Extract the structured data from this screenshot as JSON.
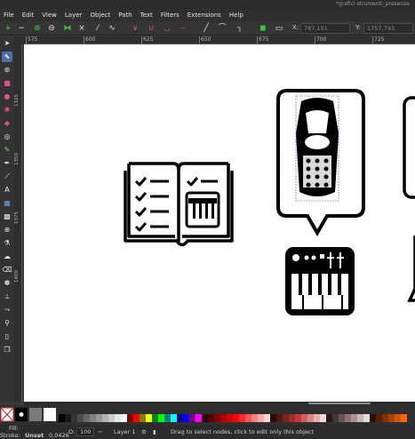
{
  "window": {
    "document_title": "*grafici strumenti_presenze"
  },
  "menubar": {
    "items": [
      "File",
      "Edit",
      "View",
      "Layer",
      "Object",
      "Path",
      "Text",
      "Filters",
      "Extensions",
      "Help"
    ]
  },
  "controls": {
    "x_label": "X:",
    "x_value": "787,151",
    "y_label": "Y:",
    "y_value": "1757,793"
  },
  "ruler": {
    "top_labels": [
      "575",
      "600",
      "625",
      "650",
      "675",
      "700",
      "725"
    ],
    "left_labels": [
      "1325",
      "1350",
      "1375",
      "1400"
    ]
  },
  "statusbar": {
    "fill_label": "Fill:",
    "stroke_label": "Stroke:",
    "stroke_value": "Unset",
    "stroke_width": "0,0426",
    "opacity_label": "O:",
    "opacity_value": "100",
    "layer_name": "Layer 1",
    "message": "Drag to select nodes, click to edit only this object"
  },
  "palette": {
    "colors": [
      "#000000",
      "#1a1a1a",
      "#333333",
      "#4d4d4d",
      "#666666",
      "#808080",
      "#999999",
      "#b3b3b3",
      "#cccccc",
      "#e6e6e6",
      "#ffffff",
      "#800000",
      "#ff0000",
      "#808000",
      "#ffff00",
      "#008000",
      "#00ff00",
      "#008080",
      "#00ffff",
      "#000080",
      "#0000ff",
      "#800080",
      "#ff00ff",
      "#2b0000",
      "#550000",
      "#800000",
      "#aa0000",
      "#d40000",
      "#ff0000",
      "#ff2a2a",
      "#ff5555",
      "#ff8080",
      "#ffaaaa",
      "#ffd5d5",
      "#280b0b",
      "#501616",
      "#782121",
      "#a02c2c",
      "#c83737",
      "#d35f5f",
      "#de8787",
      "#e9afaf",
      "#f4d7d7",
      "#241c1c",
      "#483737",
      "#6c5353",
      "#916f6f",
      "#ac9393",
      "#c8b7b7",
      "#e3dbdb",
      "#2b1100",
      "#552200",
      "#803300",
      "#aa4400",
      "#d45500",
      "#ff6600"
    ]
  }
}
